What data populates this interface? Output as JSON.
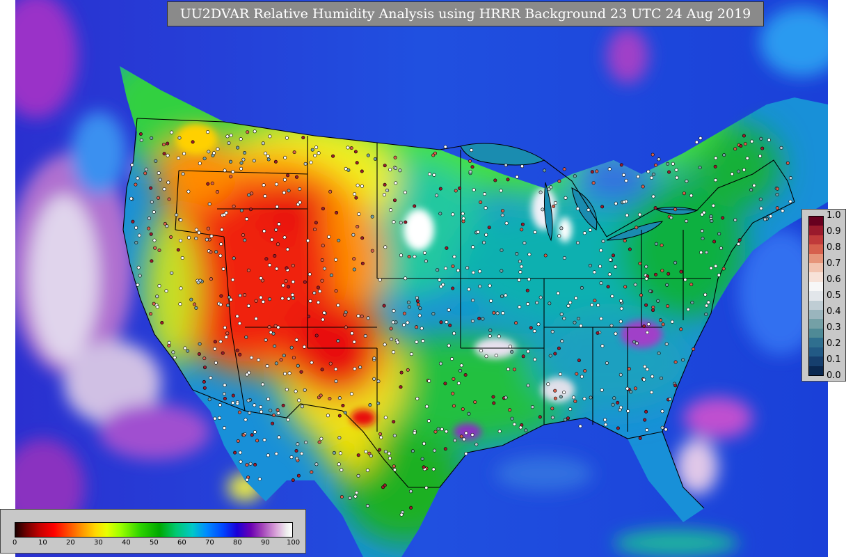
{
  "map": {
    "title": "UU2DVAR Relative Humidity Analysis using HRRR Background 23 UTC 24 Aug 2019",
    "region": "CONUS",
    "colors": {
      "ocean_deep": "#1a28d8",
      "ocean_mid": "#2a50e8",
      "ocean_light": "#3c8cf0",
      "moist_purple": "#8a2ac0",
      "saturated": "#e4e4ee",
      "green": "#18c818",
      "light_green": "#6ef03c",
      "yellow": "#f0f010",
      "orange": "#ff8c00",
      "red": "#e81010",
      "cyan": "#10b0b0",
      "teal": "#148c8c",
      "borders": "#000000",
      "station_marker": "#ffffff"
    }
  },
  "obs_colorbar": {
    "ticks": [
      "1.0",
      "0.9",
      "0.8",
      "0.7",
      "0.6",
      "0.5",
      "0.4",
      "0.3",
      "0.2",
      "0.1",
      "0.0"
    ],
    "colors": [
      "#67001f",
      "#9a1a2c",
      "#c03a3a",
      "#d6604d",
      "#e6957a",
      "#f2c4b0",
      "#f7e2d8",
      "#f7f7f7",
      "#e2e6ea",
      "#bfcdd4",
      "#9ab5bd",
      "#74a0a6",
      "#4f8a96",
      "#2f6f8f",
      "#225a85",
      "#163f6e",
      "#0a2850"
    ]
  },
  "rh_colorbar": {
    "ticks": [
      "0",
      "10",
      "20",
      "30",
      "40",
      "50",
      "60",
      "70",
      "80",
      "90",
      "100"
    ]
  }
}
